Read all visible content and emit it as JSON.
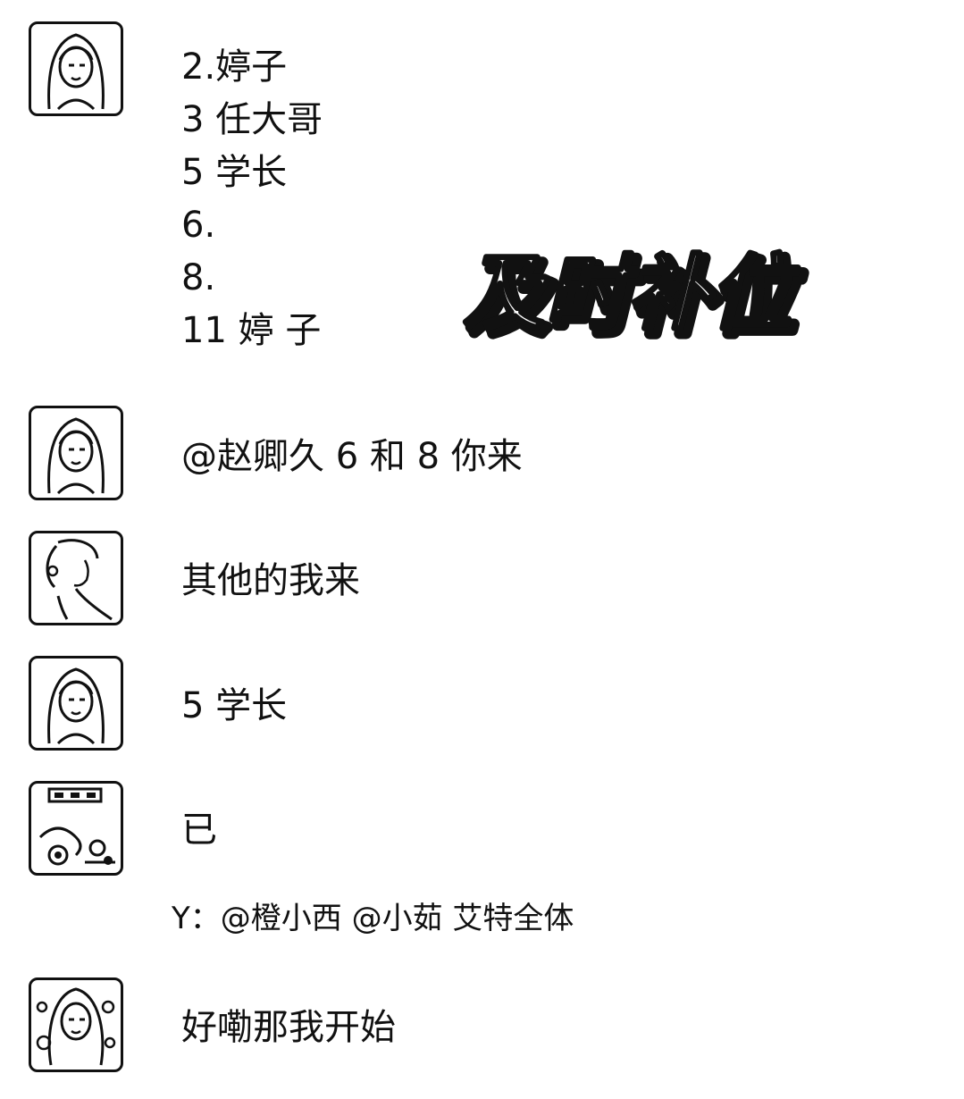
{
  "chat": {
    "messages": [
      {
        "avatar": "woman-long-hair-avatar",
        "lines": [
          "2.婷子",
          "3 任大哥",
          "5 学长",
          "6.",
          "8.",
          "11 婷 子"
        ]
      },
      {
        "avatar": "woman-long-hair-avatar",
        "text": "@赵卿久  6 和 8 你来"
      },
      {
        "avatar": "woman-profile-avatar",
        "text": "其他的我来"
      },
      {
        "avatar": "woman-long-hair-avatar",
        "text": "5 学长"
      },
      {
        "avatar": "cartoon-scene-avatar",
        "text": "已"
      },
      {
        "avatar": "woman-flowers-avatar",
        "text": "好嘞那我开始"
      }
    ],
    "system_notice": "Y：@橙小西 @小茹 艾特全体",
    "sticker_text": "及时补位"
  }
}
